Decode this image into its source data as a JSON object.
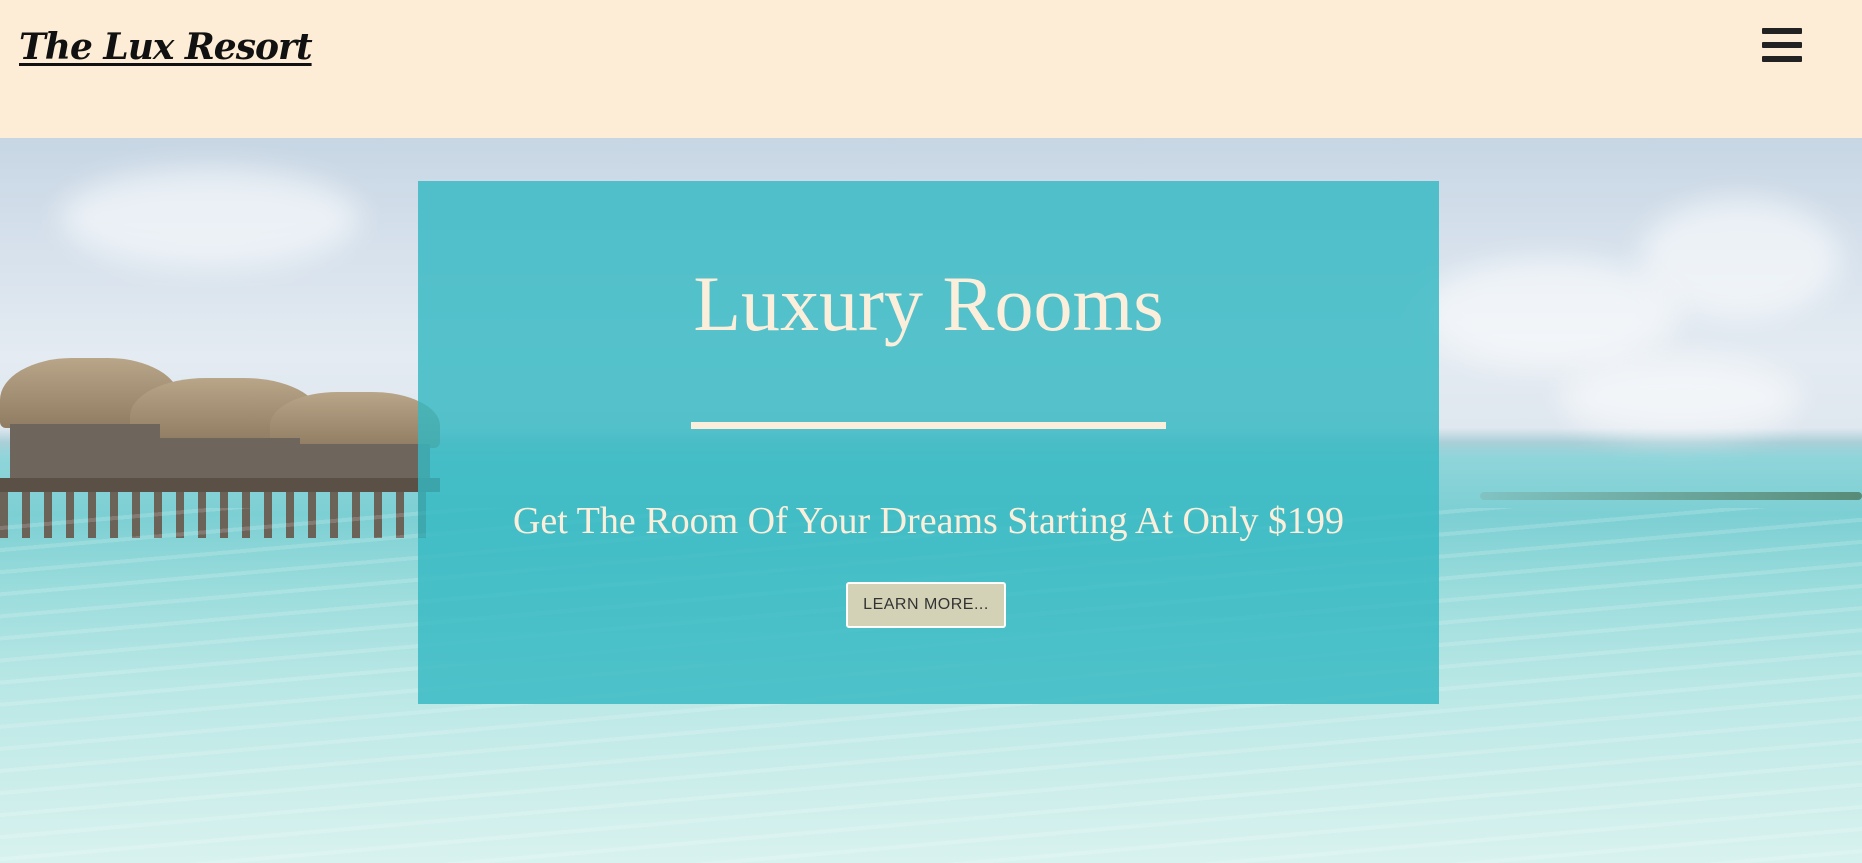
{
  "header": {
    "logo_text": "The Lux Resort",
    "background_color": "#fdedd6",
    "menu_icon": "hamburger-menu-icon"
  },
  "hero": {
    "title": "Luxury Rooms",
    "subtitle": "Get The Room Of Your Dreams Starting At Only $199",
    "button_label": "LEARN MORE...",
    "overlay_color": "#34b8c2",
    "text_color": "#fbefdc",
    "button_color": "#d4d2b6"
  }
}
